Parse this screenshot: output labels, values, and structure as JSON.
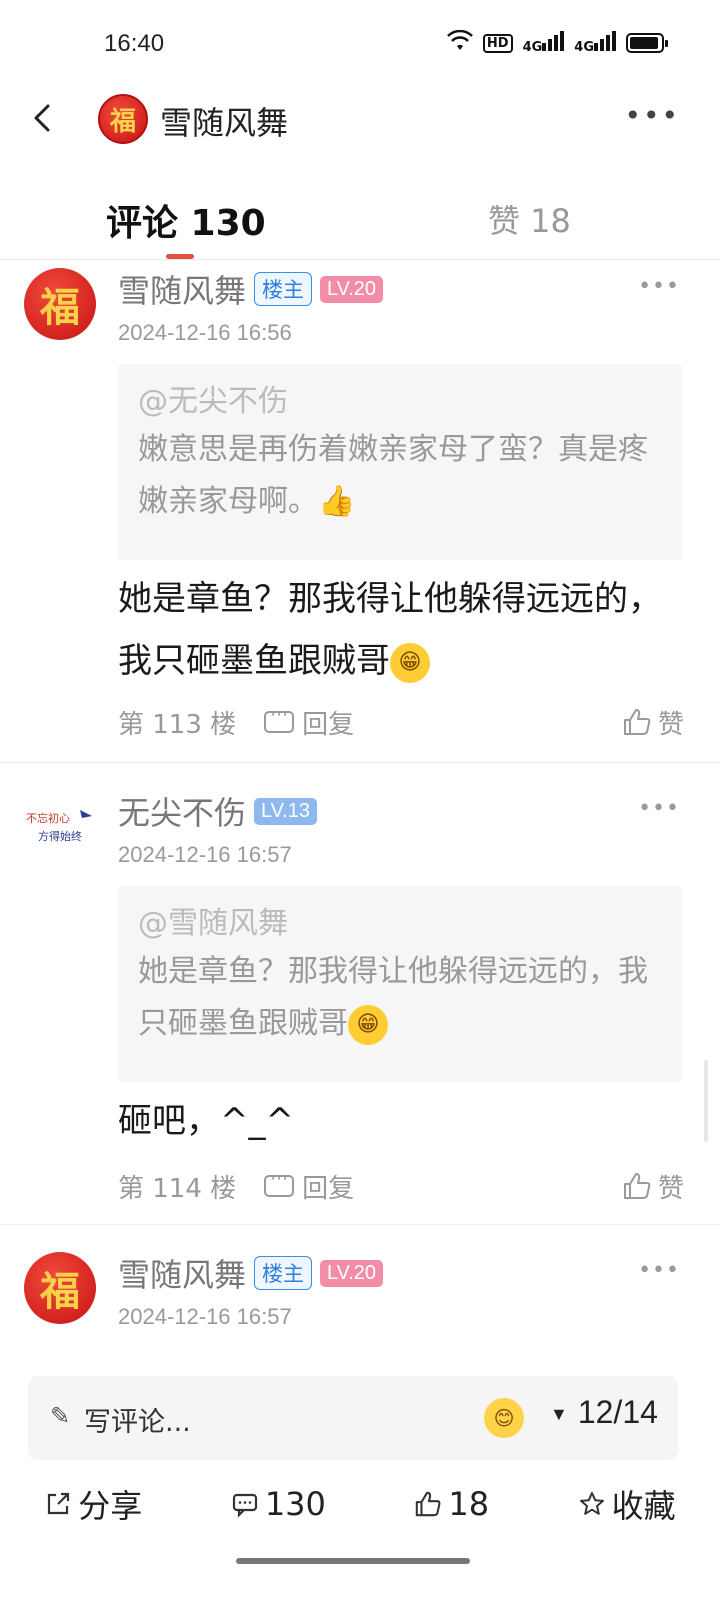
{
  "status": {
    "time": "16:40",
    "hd": "HD",
    "net1": "4G",
    "net2": "4G"
  },
  "header": {
    "title": "雪随风舞",
    "avatar_char": "福"
  },
  "tabs": {
    "comments": "评论 130",
    "likes": "赞 18"
  },
  "comments": [
    {
      "avatar_char": "福",
      "name": "雪随风舞",
      "owner_badge": "楼主",
      "level": "LV.20",
      "time": "2024-12-16 16:56",
      "quote_user": "@无尖不伤",
      "quote_text": "嫩意思是再伤着嫩亲家母了蛮？真是疼嫩亲家母啊。👍",
      "text": "她是章鱼？那我得让他躲得远远的，我只砸墨鱼跟贼哥",
      "floor": "第 113 楼",
      "reply": "回复",
      "like": "赞"
    },
    {
      "name": "无尖不伤",
      "level": "LV.13",
      "time": "2024-12-16 16:57",
      "quote_user": "@雪随风舞",
      "quote_text": "她是章鱼？那我得让他躲得远远的，我只砸墨鱼跟贼哥",
      "text": "砸吧，^_^",
      "floor": "第 114 楼",
      "reply": "回复",
      "like": "赞"
    },
    {
      "avatar_char": "福",
      "name": "雪随风舞",
      "owner_badge": "楼主",
      "level": "LV.20",
      "time": "2024-12-16 16:57"
    }
  ],
  "input": {
    "placeholder": "写评论...",
    "page": "12/14"
  },
  "actions": {
    "share": "分享",
    "comments": "130",
    "likes": "18",
    "favorite": "收藏"
  },
  "colors": {
    "accent": "#e2503f",
    "owner_badge": "#2f7fdb",
    "lv_pink": "#f18da6",
    "lv_blue": "#8fb9ee"
  }
}
